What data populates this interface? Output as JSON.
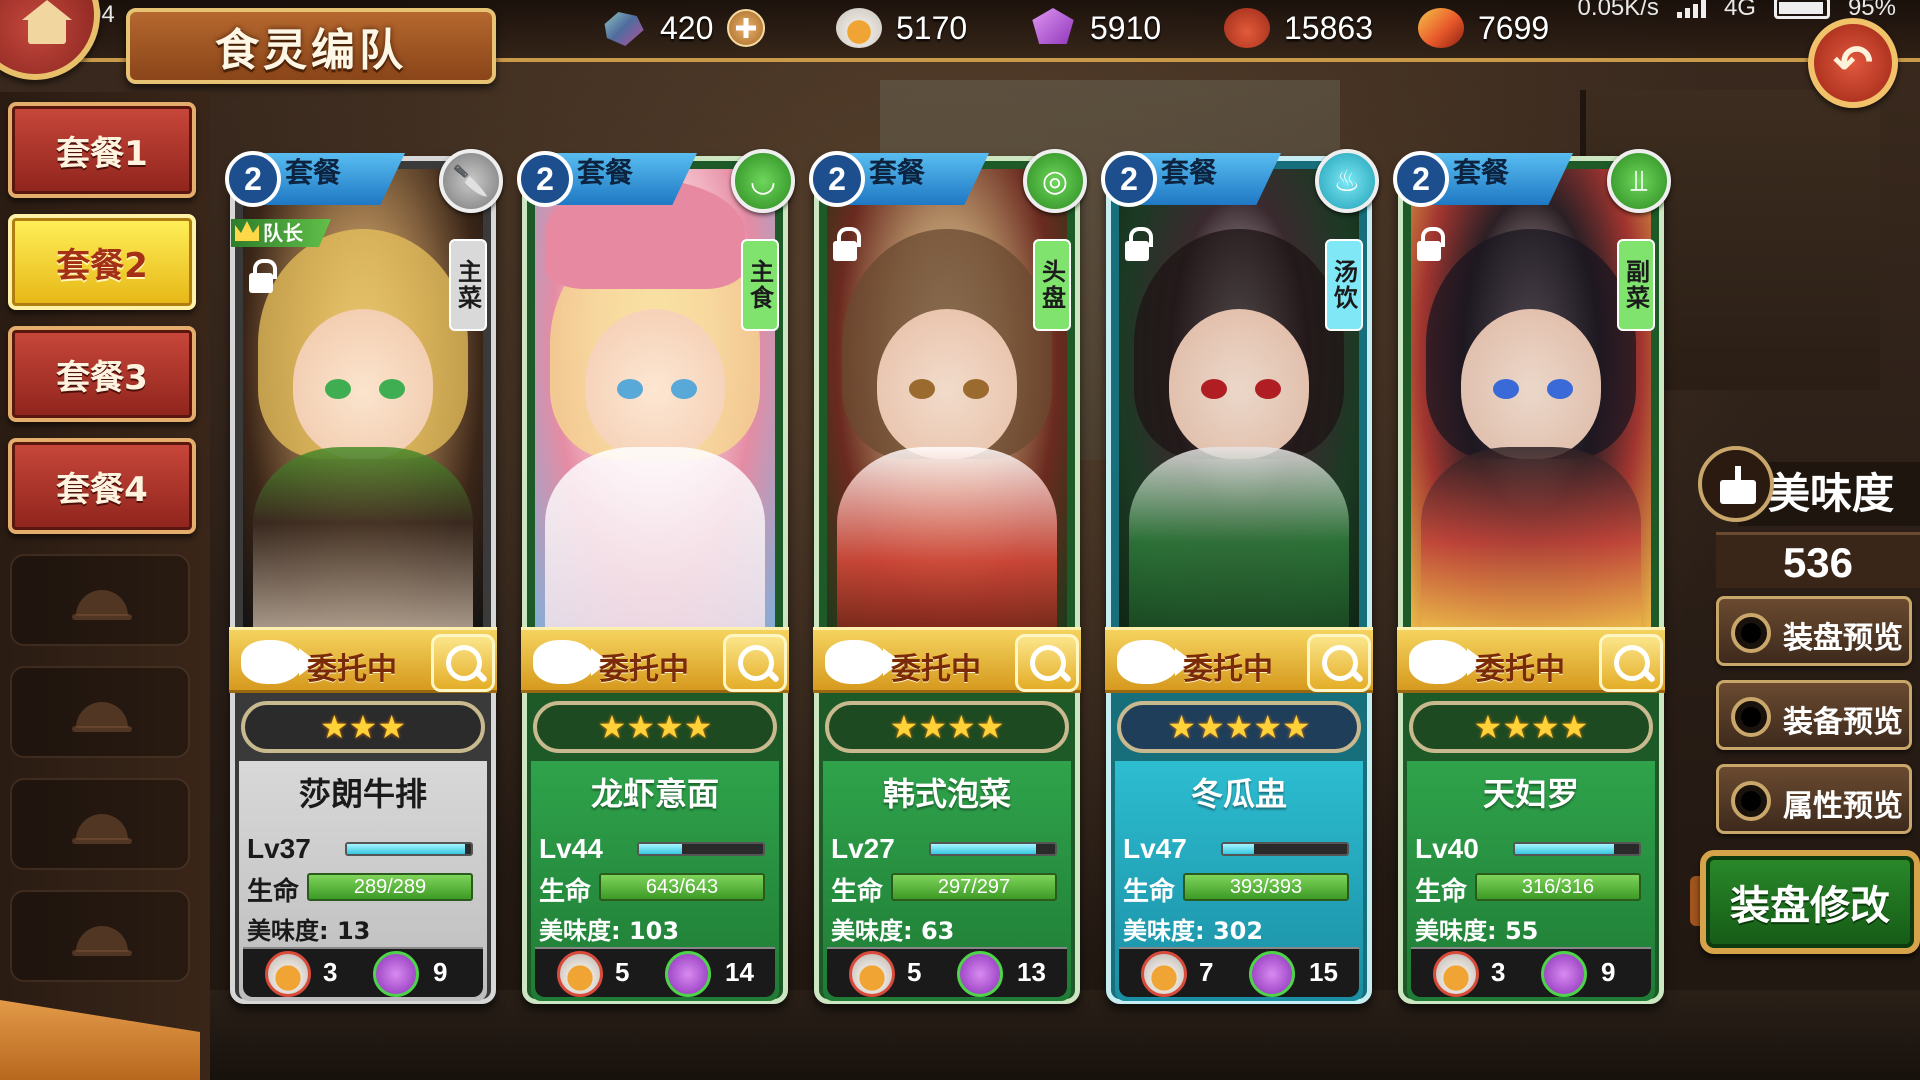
{
  "status_bar": {
    "time": "上午7:04",
    "network_speed": "0.05K/s",
    "network_type": "4G",
    "battery": "95%"
  },
  "header": {
    "title": "食灵编队",
    "currencies": [
      {
        "icon": "gem-icon",
        "value": "420"
      },
      {
        "icon": "oil-icon",
        "value": "5170"
      },
      {
        "icon": "crystal-icon",
        "value": "5910"
      },
      {
        "icon": "bowl-icon",
        "value": "15863"
      },
      {
        "icon": "stamina-icon",
        "value": "7699"
      }
    ]
  },
  "sidebar": {
    "sets": [
      {
        "label": "套餐1",
        "active": false
      },
      {
        "label": "套餐2",
        "active": true
      },
      {
        "label": "套餐3",
        "active": false
      },
      {
        "label": "套餐4",
        "active": false
      }
    ],
    "empty_slot_count": 4
  },
  "cards": [
    {
      "level_badge": "2",
      "header_label": "套餐",
      "type": "主菜",
      "type_icon": "knife-icon",
      "captain_label": "队长",
      "commission": "委托中",
      "stars": 3,
      "name": "莎朗牛排",
      "lv": "Lv37",
      "xp_fraction": 0.95,
      "hp_label": "生命",
      "hp": "289/289",
      "taste_label": "美味度: 13",
      "oil_cost": "3",
      "crystal_cost": "9",
      "theme": "gray"
    },
    {
      "level_badge": "2",
      "header_label": "套餐",
      "type": "主食",
      "type_icon": "bowl-icon",
      "commission": "委托中",
      "stars": 4,
      "name": "龙虾意面",
      "lv": "Lv44",
      "xp_fraction": 0.35,
      "hp_label": "生命",
      "hp": "643/643",
      "taste_label": "美味度: 103",
      "oil_cost": "5",
      "crystal_cost": "14",
      "theme": "green"
    },
    {
      "level_badge": "2",
      "header_label": "套餐",
      "type": "头盘",
      "type_icon": "plate-icon",
      "commission": "委托中",
      "stars": 4,
      "name": "韩式泡菜",
      "lv": "Lv27",
      "xp_fraction": 0.85,
      "hp_label": "生命",
      "hp": "297/297",
      "taste_label": "美味度: 63",
      "oil_cost": "5",
      "crystal_cost": "13",
      "theme": "green"
    },
    {
      "level_badge": "2",
      "header_label": "套餐",
      "type": "汤饮",
      "type_icon": "soup-icon",
      "commission": "委托中",
      "stars": 5,
      "name": "冬瓜盅",
      "lv": "Lv47",
      "xp_fraction": 0.25,
      "hp_label": "生命",
      "hp": "393/393",
      "taste_label": "美味度: 302",
      "oil_cost": "7",
      "crystal_cost": "15",
      "theme": "cyan"
    },
    {
      "level_badge": "2",
      "header_label": "套餐",
      "type": "副菜",
      "type_icon": "fork-icon",
      "commission": "委托中",
      "stars": 4,
      "name": "天妇罗",
      "lv": "Lv40",
      "xp_fraction": 0.8,
      "hp_label": "生命",
      "hp": "316/316",
      "taste_label": "美味度: 55",
      "oil_cost": "3",
      "crystal_cost": "9",
      "theme": "green"
    }
  ],
  "right_panel": {
    "taste_title": "美味度",
    "taste_value": "536",
    "buttons": [
      "装盘预览",
      "装备预览",
      "属性预览"
    ],
    "modify_label": "装盘修改"
  }
}
